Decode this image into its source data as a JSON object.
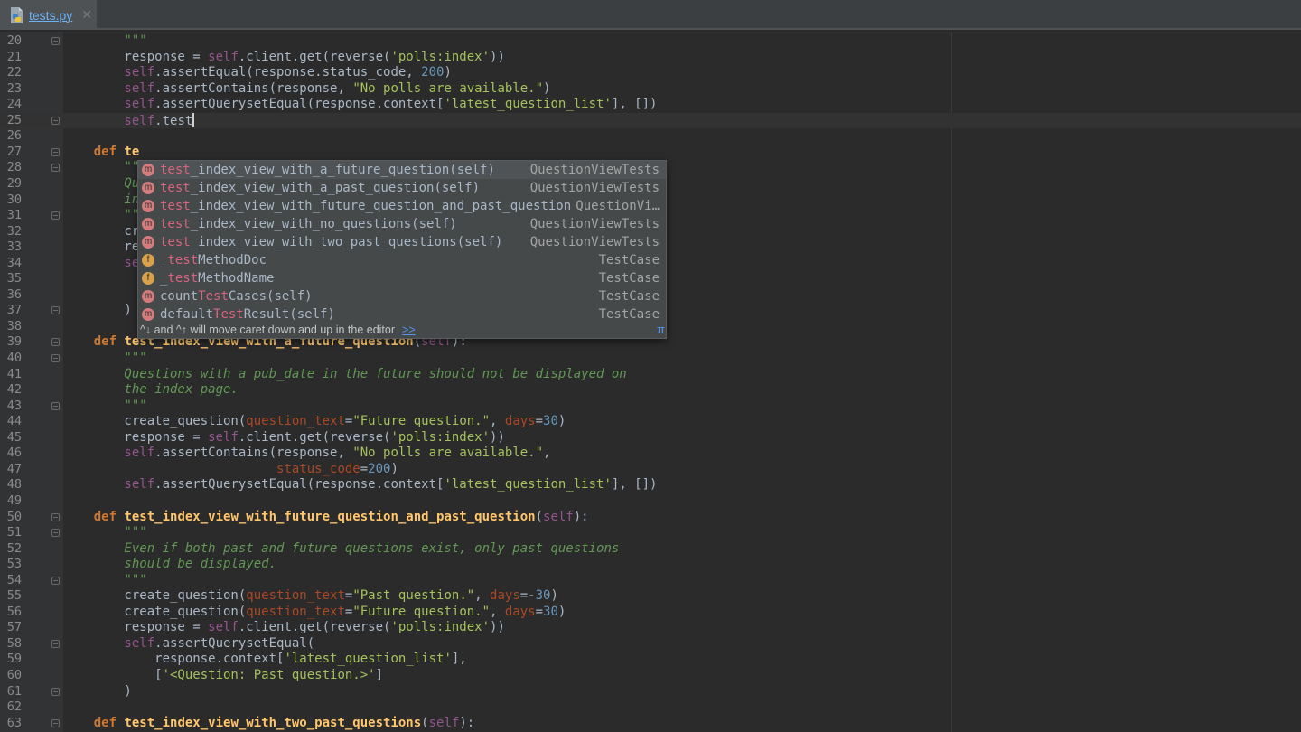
{
  "tab": {
    "filename": "tests.py",
    "close": "✕"
  },
  "lines": [
    {
      "n": "20",
      "fold": true,
      "t": [
        [
          "tok-doc",
          "        \"\"\""
        ]
      ]
    },
    {
      "n": "21",
      "t": [
        [
          "tok-plain",
          "        response = "
        ],
        [
          "tok-self",
          "self"
        ],
        [
          "tok-plain",
          ".client.get(reverse("
        ],
        [
          "tok-str",
          "'polls:index'"
        ],
        [
          "tok-plain",
          "))"
        ]
      ]
    },
    {
      "n": "22",
      "t": [
        [
          "tok-self",
          "        self"
        ],
        [
          "tok-plain",
          ".assertEqual(response.status_code, "
        ],
        [
          "tok-num",
          "200"
        ],
        [
          "tok-plain",
          ")"
        ]
      ]
    },
    {
      "n": "23",
      "t": [
        [
          "tok-self",
          "        self"
        ],
        [
          "tok-plain",
          ".assertContains(response, "
        ],
        [
          "tok-str",
          "\"No polls are available.\""
        ],
        [
          "tok-plain",
          ")"
        ]
      ]
    },
    {
      "n": "24",
      "t": [
        [
          "tok-self",
          "        self"
        ],
        [
          "tok-plain",
          ".assertQuerysetEqual(response.context["
        ],
        [
          "tok-str",
          "'latest_question_list'"
        ],
        [
          "tok-plain",
          "], [])"
        ]
      ]
    },
    {
      "n": "25",
      "fold": true,
      "current": true,
      "caret": true,
      "t": [
        [
          "tok-self",
          "        self"
        ],
        [
          "tok-plain",
          ".test"
        ]
      ]
    },
    {
      "n": "26",
      "t": []
    },
    {
      "n": "27",
      "fold": true,
      "t": [
        [
          "tok-kw",
          "    def "
        ],
        [
          "tok-fn",
          "te"
        ]
      ]
    },
    {
      "n": "28",
      "fold": true,
      "t": [
        [
          "tok-doc",
          "        \"\""
        ]
      ]
    },
    {
      "n": "29",
      "t": [
        [
          "tok-doc",
          "        Qu"
        ]
      ]
    },
    {
      "n": "30",
      "t": [
        [
          "tok-doc",
          "        in"
        ]
      ]
    },
    {
      "n": "31",
      "fold": true,
      "t": [
        [
          "tok-doc",
          "        \"\""
        ]
      ]
    },
    {
      "n": "32",
      "t": [
        [
          "tok-plain",
          "        cr"
        ]
      ]
    },
    {
      "n": "33",
      "t": [
        [
          "tok-plain",
          "        re"
        ]
      ]
    },
    {
      "n": "34",
      "t": [
        [
          "tok-self",
          "        se"
        ]
      ]
    },
    {
      "n": "35",
      "t": []
    },
    {
      "n": "36",
      "t": []
    },
    {
      "n": "37",
      "fold": true,
      "t": [
        [
          "tok-plain",
          "        )"
        ]
      ]
    },
    {
      "n": "38",
      "t": []
    },
    {
      "n": "39",
      "fold": true,
      "t": [
        [
          "tok-kw",
          "    def "
        ],
        [
          "tok-fn",
          "test_index_view_with_a_future_question"
        ],
        [
          "tok-plain",
          "("
        ],
        [
          "tok-self",
          "self"
        ],
        [
          "tok-plain",
          "):"
        ]
      ]
    },
    {
      "n": "40",
      "fold": true,
      "t": [
        [
          "tok-doc",
          "        \"\"\""
        ]
      ]
    },
    {
      "n": "41",
      "t": [
        [
          "tok-doc",
          "        Questions with a pub_date in the future should not be displayed on"
        ]
      ]
    },
    {
      "n": "42",
      "t": [
        [
          "tok-doc",
          "        the index page."
        ]
      ]
    },
    {
      "n": "43",
      "fold": true,
      "t": [
        [
          "tok-doc",
          "        \"\"\""
        ]
      ]
    },
    {
      "n": "44",
      "t": [
        [
          "tok-plain",
          "        create_question("
        ],
        [
          "tok-param",
          "question_text"
        ],
        [
          "tok-plain",
          "="
        ],
        [
          "tok-str",
          "\"Future question.\""
        ],
        [
          "tok-plain",
          ", "
        ],
        [
          "tok-param",
          "days"
        ],
        [
          "tok-plain",
          "="
        ],
        [
          "tok-num",
          "30"
        ],
        [
          "tok-plain",
          ")"
        ]
      ]
    },
    {
      "n": "45",
      "t": [
        [
          "tok-plain",
          "        response = "
        ],
        [
          "tok-self",
          "self"
        ],
        [
          "tok-plain",
          ".client.get(reverse("
        ],
        [
          "tok-str",
          "'polls:index'"
        ],
        [
          "tok-plain",
          "))"
        ]
      ]
    },
    {
      "n": "46",
      "t": [
        [
          "tok-self",
          "        self"
        ],
        [
          "tok-plain",
          ".assertContains(response, "
        ],
        [
          "tok-str",
          "\"No polls are available.\""
        ],
        [
          "tok-plain",
          ","
        ]
      ]
    },
    {
      "n": "47",
      "t": [
        [
          "tok-plain",
          "                            "
        ],
        [
          "tok-param",
          "status_code"
        ],
        [
          "tok-plain",
          "="
        ],
        [
          "tok-num",
          "200"
        ],
        [
          "tok-plain",
          ")"
        ]
      ]
    },
    {
      "n": "48",
      "t": [
        [
          "tok-self",
          "        self"
        ],
        [
          "tok-plain",
          ".assertQuerysetEqual(response.context["
        ],
        [
          "tok-str",
          "'latest_question_list'"
        ],
        [
          "tok-plain",
          "], [])"
        ]
      ]
    },
    {
      "n": "49",
      "t": []
    },
    {
      "n": "50",
      "fold": true,
      "t": [
        [
          "tok-kw",
          "    def "
        ],
        [
          "tok-fn",
          "test_index_view_with_future_question_and_past_question"
        ],
        [
          "tok-plain",
          "("
        ],
        [
          "tok-self",
          "self"
        ],
        [
          "tok-plain",
          "):"
        ]
      ]
    },
    {
      "n": "51",
      "fold": true,
      "t": [
        [
          "tok-doc",
          "        \"\"\""
        ]
      ]
    },
    {
      "n": "52",
      "t": [
        [
          "tok-doc",
          "        Even if both past and future questions exist, only past questions"
        ]
      ]
    },
    {
      "n": "53",
      "t": [
        [
          "tok-doc",
          "        should be displayed."
        ]
      ]
    },
    {
      "n": "54",
      "fold": true,
      "t": [
        [
          "tok-doc",
          "        \"\"\""
        ]
      ]
    },
    {
      "n": "55",
      "t": [
        [
          "tok-plain",
          "        create_question("
        ],
        [
          "tok-param",
          "question_text"
        ],
        [
          "tok-plain",
          "="
        ],
        [
          "tok-str",
          "\"Past question.\""
        ],
        [
          "tok-plain",
          ", "
        ],
        [
          "tok-param",
          "days"
        ],
        [
          "tok-plain",
          "=-"
        ],
        [
          "tok-num",
          "30"
        ],
        [
          "tok-plain",
          ")"
        ]
      ]
    },
    {
      "n": "56",
      "t": [
        [
          "tok-plain",
          "        create_question("
        ],
        [
          "tok-param",
          "question_text"
        ],
        [
          "tok-plain",
          "="
        ],
        [
          "tok-str",
          "\"Future question.\""
        ],
        [
          "tok-plain",
          ", "
        ],
        [
          "tok-param",
          "days"
        ],
        [
          "tok-plain",
          "="
        ],
        [
          "tok-num",
          "30"
        ],
        [
          "tok-plain",
          ")"
        ]
      ]
    },
    {
      "n": "57",
      "t": [
        [
          "tok-plain",
          "        response = "
        ],
        [
          "tok-self",
          "self"
        ],
        [
          "tok-plain",
          ".client.get(reverse("
        ],
        [
          "tok-str",
          "'polls:index'"
        ],
        [
          "tok-plain",
          "))"
        ]
      ]
    },
    {
      "n": "58",
      "fold": true,
      "t": [
        [
          "tok-self",
          "        self"
        ],
        [
          "tok-plain",
          ".assertQuerysetEqual("
        ]
      ]
    },
    {
      "n": "59",
      "t": [
        [
          "tok-plain",
          "            response.context["
        ],
        [
          "tok-str",
          "'latest_question_list'"
        ],
        [
          "tok-plain",
          "],"
        ]
      ]
    },
    {
      "n": "60",
      "t": [
        [
          "tok-plain",
          "            ["
        ],
        [
          "tok-str",
          "'<Question: Past question.>'"
        ],
        [
          "tok-plain",
          "]"
        ]
      ]
    },
    {
      "n": "61",
      "fold": true,
      "t": [
        [
          "tok-plain",
          "        )"
        ]
      ]
    },
    {
      "n": "62",
      "t": []
    },
    {
      "n": "63",
      "fold": true,
      "t": [
        [
          "tok-kw",
          "    def "
        ],
        [
          "tok-fn",
          "test_index_view_with_two_past_questions"
        ],
        [
          "tok-plain",
          "("
        ],
        [
          "tok-self",
          "self"
        ],
        [
          "tok-plain",
          "):"
        ]
      ]
    }
  ],
  "completion": {
    "items": [
      {
        "kind": "m",
        "pre": "",
        "match": "test",
        "post": "_index_view_with_a_future_question(self)",
        "type": "QuestionViewTests",
        "selected": true
      },
      {
        "kind": "m",
        "pre": "",
        "match": "test",
        "post": "_index_view_with_a_past_question(self)",
        "type": "QuestionViewTests"
      },
      {
        "kind": "m",
        "pre": "",
        "match": "test",
        "post": "_index_view_with_future_question_and_past_question",
        "type": "QuestionVi…"
      },
      {
        "kind": "m",
        "pre": "",
        "match": "test",
        "post": "_index_view_with_no_questions(self)",
        "type": "QuestionViewTests"
      },
      {
        "kind": "m",
        "pre": "",
        "match": "test",
        "post": "_index_view_with_two_past_questions(self)",
        "type": "QuestionViewTests"
      },
      {
        "kind": "f",
        "pre": "_",
        "match": "test",
        "post": "MethodDoc",
        "type": "TestCase"
      },
      {
        "kind": "f",
        "pre": "_",
        "match": "test",
        "post": "MethodName",
        "type": "TestCase"
      },
      {
        "kind": "m",
        "pre": "count",
        "match": "Test",
        "post": "Cases(self)",
        "type": "TestCase"
      },
      {
        "kind": "m",
        "pre": "default",
        "match": "Test",
        "post": "Result(self)",
        "type": "TestCase"
      }
    ],
    "hint": "^↓ and ^↑ will move caret down and up in the editor",
    "hint_link": ">>",
    "pi": "π"
  }
}
